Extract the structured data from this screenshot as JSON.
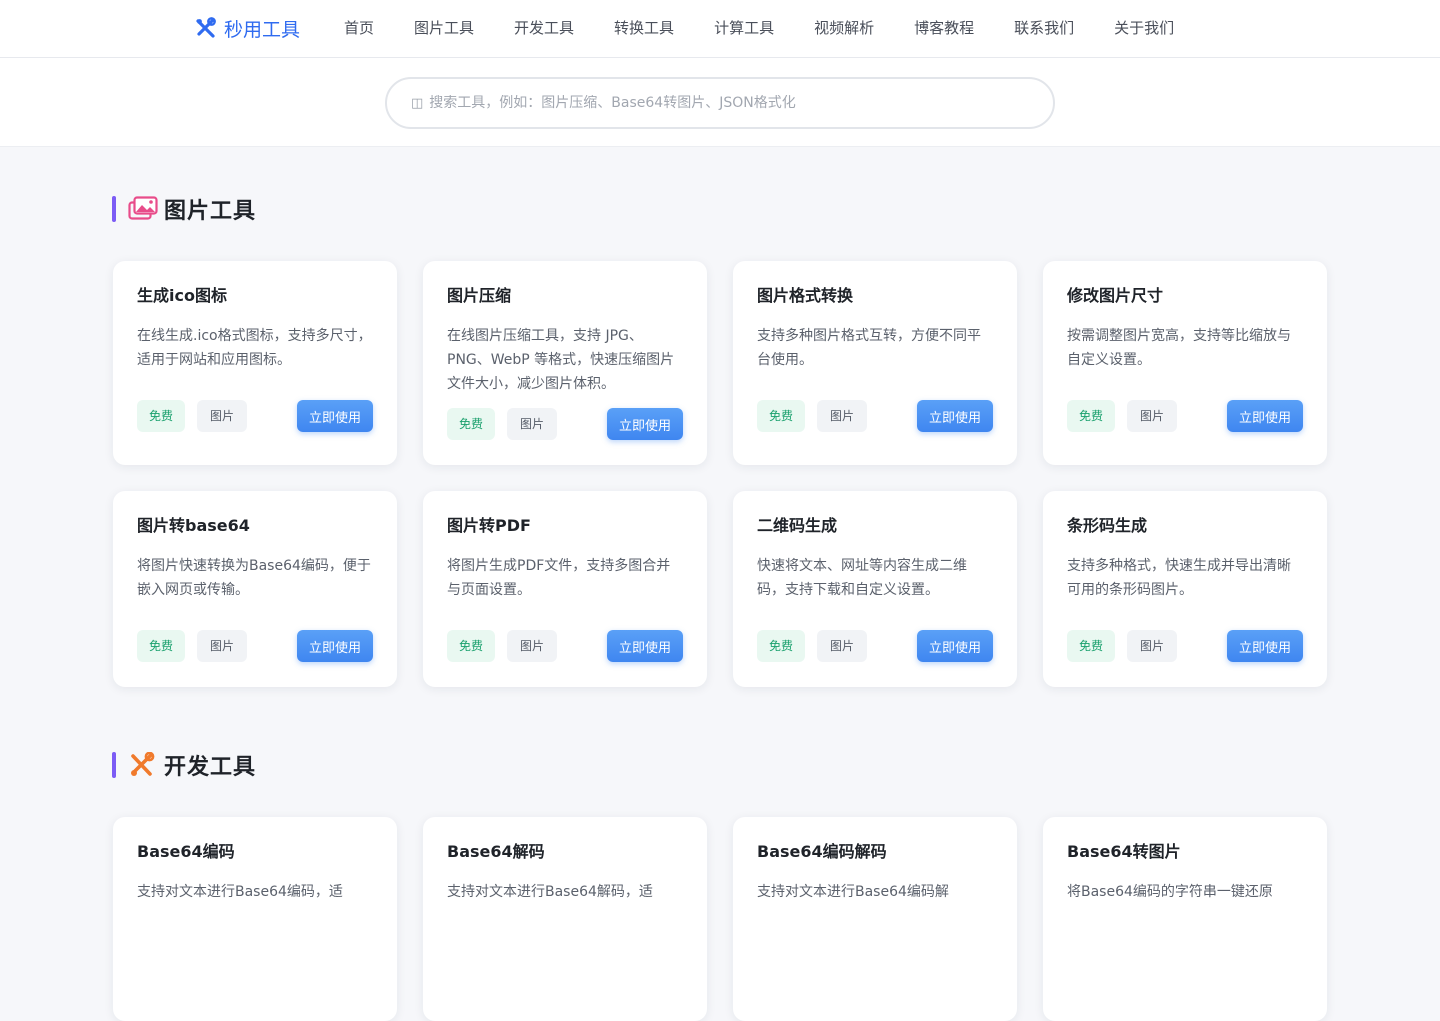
{
  "header": {
    "brand": "秒用工具",
    "nav": [
      "首页",
      "图片工具",
      "开发工具",
      "转换工具",
      "计算工具",
      "视频解析",
      "博客教程",
      "联系我们",
      "关于我们"
    ]
  },
  "search": {
    "placeholder": "搜索工具，例如：图片压缩、Base64转图片、JSON格式化"
  },
  "sections": [
    {
      "title": "图片工具",
      "icon": "images-icon",
      "cards": [
        {
          "title": "生成ico图标",
          "desc": "在线生成.ico格式图标，支持多尺寸，适用于网站和应用图标。",
          "free": "免费",
          "tag": "图片",
          "button": "立即使用"
        },
        {
          "title": "图片压缩",
          "desc": "在线图片压缩工具，支持 JPG、PNG、WebP 等格式，快速压缩图片文件大小，减少图片体积。",
          "free": "免费",
          "tag": "图片",
          "button": "立即使用"
        },
        {
          "title": "图片格式转换",
          "desc": "支持多种图片格式互转，方便不同平台使用。",
          "free": "免费",
          "tag": "图片",
          "button": "立即使用"
        },
        {
          "title": "修改图片尺寸",
          "desc": "按需调整图片宽高，支持等比缩放与自定义设置。",
          "free": "免费",
          "tag": "图片",
          "button": "立即使用"
        },
        {
          "title": "图片转base64",
          "desc": "将图片快速转换为Base64编码，便于嵌入网页或传输。",
          "free": "免费",
          "tag": "图片",
          "button": "立即使用"
        },
        {
          "title": "图片转PDF",
          "desc": "将图片生成PDF文件，支持多图合并与页面设置。",
          "free": "免费",
          "tag": "图片",
          "button": "立即使用"
        },
        {
          "title": "二维码生成",
          "desc": "快速将文本、网址等内容生成二维码，支持下载和自定义设置。",
          "free": "免费",
          "tag": "图片",
          "button": "立即使用"
        },
        {
          "title": "条形码生成",
          "desc": "支持多种格式，快速生成并导出清晰可用的条形码图片。",
          "free": "免费",
          "tag": "图片",
          "button": "立即使用"
        }
      ]
    },
    {
      "title": "开发工具",
      "icon": "tools-icon",
      "cards": [
        {
          "title": "Base64编码",
          "desc": "支持对文本进行Base64编码，适"
        },
        {
          "title": "Base64解码",
          "desc": "支持对文本进行Base64解码，适"
        },
        {
          "title": "Base64编码解码",
          "desc": "支持对文本进行Base64编码解"
        },
        {
          "title": "Base64转图片",
          "desc": "将Base64编码的字符串一键还原"
        }
      ]
    }
  ],
  "colors": {
    "brand": "#2f6bf0",
    "accent_bar": "#7c5cf5",
    "button": "#3f86f0",
    "free_tag": "#1aa06d"
  }
}
